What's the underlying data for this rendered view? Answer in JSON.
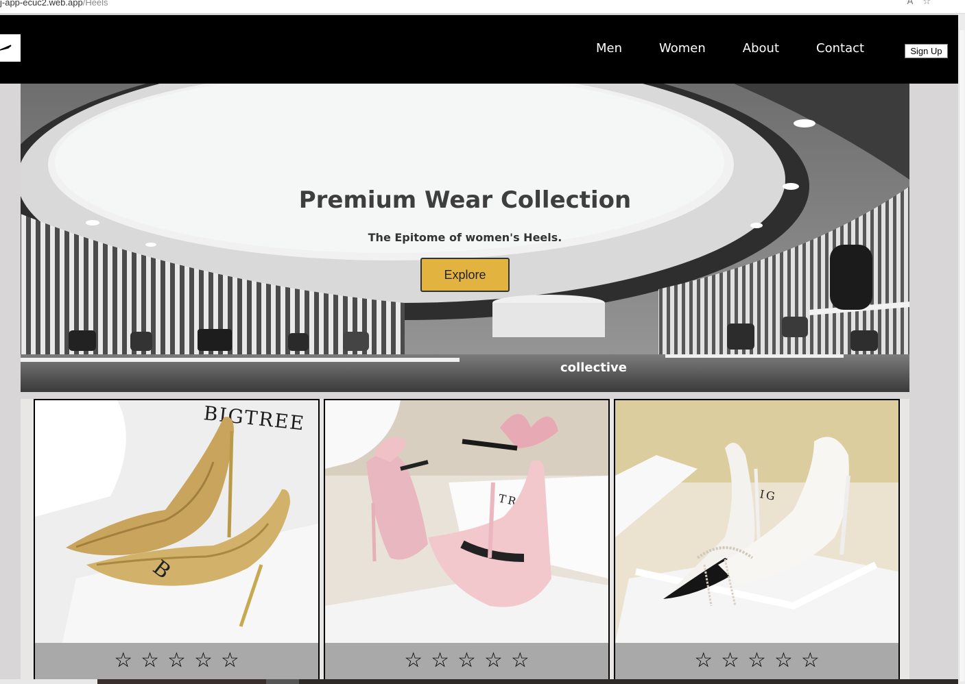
{
  "browser": {
    "url_domain": "j-app-ecuc2.web.app",
    "url_path": "/Heels",
    "icons": [
      "read-aloud-icon",
      "favorites-icon"
    ]
  },
  "navbar": {
    "logo": "swoosh-logo-icon",
    "links": [
      "Men",
      "Women",
      "About",
      "Contact"
    ],
    "signup_label": "Sign Up"
  },
  "hero": {
    "title": "Premium Wear Collection",
    "subtitle": "The Epitome of women's Heels.",
    "button_label": "Explore",
    "store_sign": "collective",
    "button_color": "#e2b33f"
  },
  "products": [
    {
      "brand_print": "BIGTREE",
      "shoe": "gold glitter pump",
      "stars": 0,
      "max_stars": 5
    },
    {
      "brand_print": "TREE",
      "shoe": "pink satin bow heel",
      "stars": 0,
      "max_stars": 5
    },
    {
      "brand_print": "IG",
      "shoe": "black and white pearl pump",
      "stars": 0,
      "max_stars": 5
    }
  ],
  "colors": {
    "navbar": "#000000",
    "rating_bar": "#a9a9a9",
    "page_bg": "#d8d6d6"
  }
}
